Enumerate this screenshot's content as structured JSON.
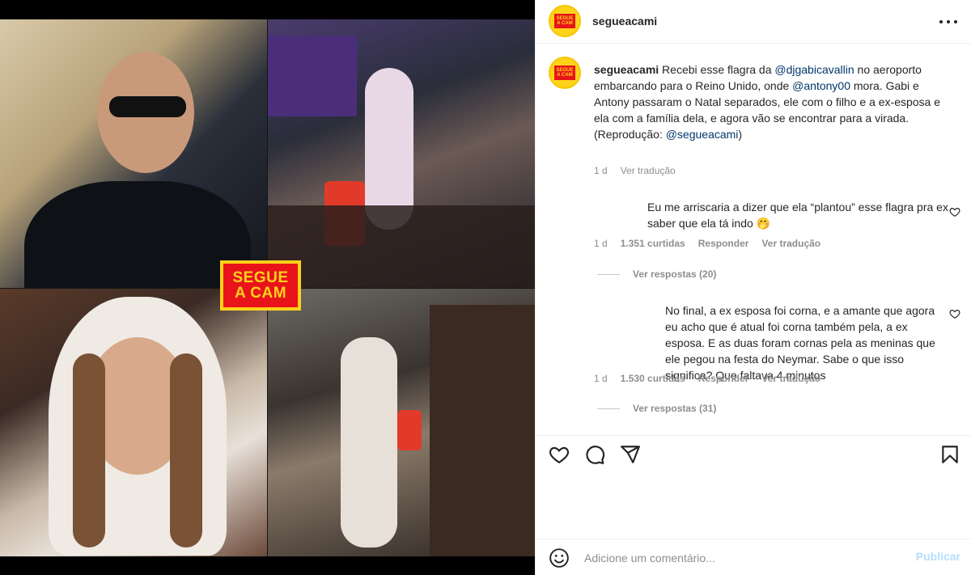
{
  "post": {
    "username": "segueacami",
    "logo_lines": [
      "SEGUE",
      "A CAM"
    ]
  },
  "caption": {
    "username": "segueacami",
    "part1": " Recebi esse flagra da ",
    "mention1": "@djgabicavallin",
    "part2": " no aeroporto embarcando para o Reino Unido, onde ",
    "mention2": "@antony00",
    "part3": " mora. Gabi e Antony passaram o Natal separados, ele com o filho e a ex-esposa e ela com a família dela, e agora vão se encontrar para a virada.",
    "part4": "(Reprodução: ",
    "mention3": "@segueacami",
    "part5": ")",
    "time": "1 d",
    "translate": "Ver tradução"
  },
  "comments": [
    {
      "text": "Eu me arriscaria a dizer que ela “plantou” esse flagra pra ex saber que ela tá indo 🤭",
      "time": "1 d",
      "likes": "1.351 curtidas",
      "reply": "Responder",
      "translate": "Ver tradução",
      "view_replies": "Ver respostas (20)"
    },
    {
      "text": "No final, a ex esposa foi corna, e a amante que agora eu acho que é atual foi corna também pela, a ex esposa. E as duas foram cornas pela as meninas que ele pegou na festa do Neymar. Sabe o que isso significa? Que faltava 4 minutos",
      "time": "1 d",
      "likes": "1.530 curtidas",
      "reply": "Responder",
      "translate": "Ver tradução",
      "view_replies": "Ver respostas (31)"
    }
  ],
  "composer": {
    "placeholder": "Adicione um comentário...",
    "publish": "Publicar"
  },
  "colors": {
    "brand_red": "#e8141a",
    "brand_yellow": "#ffd21a",
    "link": "#00376b",
    "muted": "#8e8e8e",
    "publish_disabled": "#b2dffc"
  },
  "icons": [
    "more-options-icon",
    "heart-icon",
    "comment-icon",
    "share-icon",
    "bookmark-icon",
    "emoji-icon"
  ]
}
